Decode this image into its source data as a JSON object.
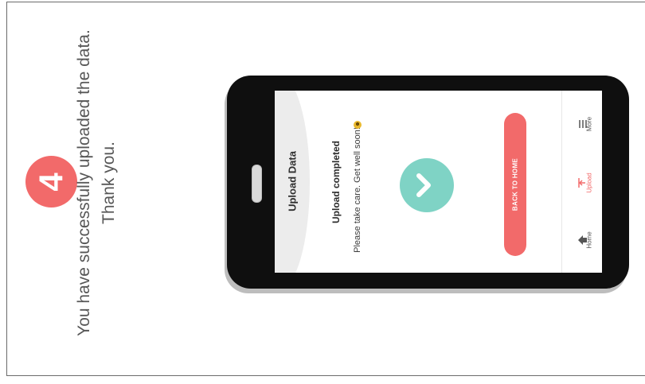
{
  "instruction": {
    "step_number": "4",
    "line1": "You have successfully uploaded the data.",
    "line2": "Thank you."
  },
  "app": {
    "screen_title": "Upload Data",
    "status_heading": "Upload completed",
    "status_message": "Please take care. Get well soon!",
    "back_button_label": "BACK TO HOME",
    "tabs": [
      {
        "label": "Home",
        "icon": "home-icon"
      },
      {
        "label": "Upload",
        "icon": "upload-icon"
      },
      {
        "label": "More",
        "icon": "menu-icon"
      }
    ]
  },
  "colors": {
    "accent": "#f26a6a",
    "success": "#7fd3c5",
    "phone_body": "#0f0f0f"
  }
}
